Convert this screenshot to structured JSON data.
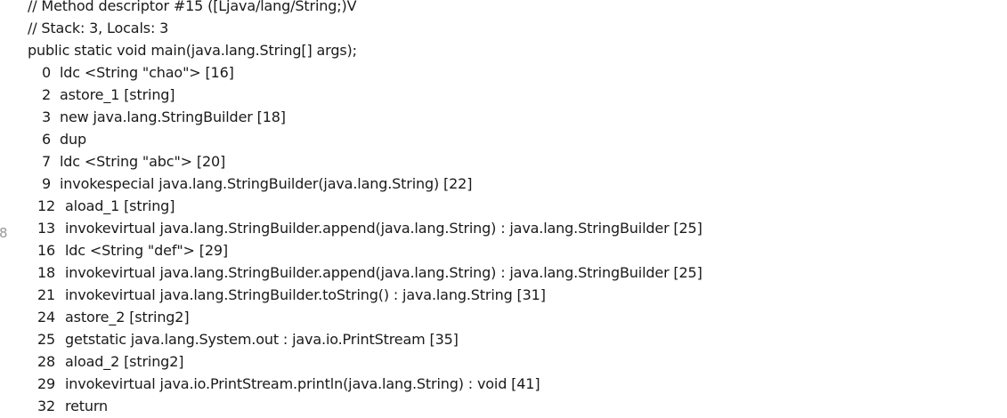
{
  "gutter_marker": "8",
  "header": {
    "descriptor_comment": "// Method descriptor #15 ([Ljava/lang/String;)V",
    "stack_comment": "// Stack: 3, Locals: 3",
    "signature": "public static void main(java.lang.String[] args);"
  },
  "instructions": [
    {
      "offset": "0",
      "text": "ldc <String \"chao\"> [16]"
    },
    {
      "offset": "2",
      "text": "astore_1 [string]"
    },
    {
      "offset": "3",
      "text": "new java.lang.StringBuilder [18]"
    },
    {
      "offset": "6",
      "text": "dup"
    },
    {
      "offset": "7",
      "text": "ldc <String \"abc\"> [20]"
    },
    {
      "offset": "9",
      "text": "invokespecial java.lang.StringBuilder(java.lang.String) [22]"
    },
    {
      "offset": "12",
      "text": "aload_1 [string]"
    },
    {
      "offset": "13",
      "text": "invokevirtual java.lang.StringBuilder.append(java.lang.String) : java.lang.StringBuilder [25]"
    },
    {
      "offset": "16",
      "text": "ldc <String \"def\"> [29]"
    },
    {
      "offset": "18",
      "text": "invokevirtual java.lang.StringBuilder.append(java.lang.String) : java.lang.StringBuilder [25]"
    },
    {
      "offset": "21",
      "text": "invokevirtual java.lang.StringBuilder.toString() : java.lang.String [31]"
    },
    {
      "offset": "24",
      "text": "astore_2 [string2]"
    },
    {
      "offset": "25",
      "text": "getstatic java.lang.System.out : java.io.PrintStream [35]"
    },
    {
      "offset": "28",
      "text": "aload_2 [string2]"
    },
    {
      "offset": "29",
      "text": "invokevirtual java.io.PrintStream.println(java.lang.String) : void [41]"
    },
    {
      "offset": "32",
      "text": "return"
    }
  ]
}
